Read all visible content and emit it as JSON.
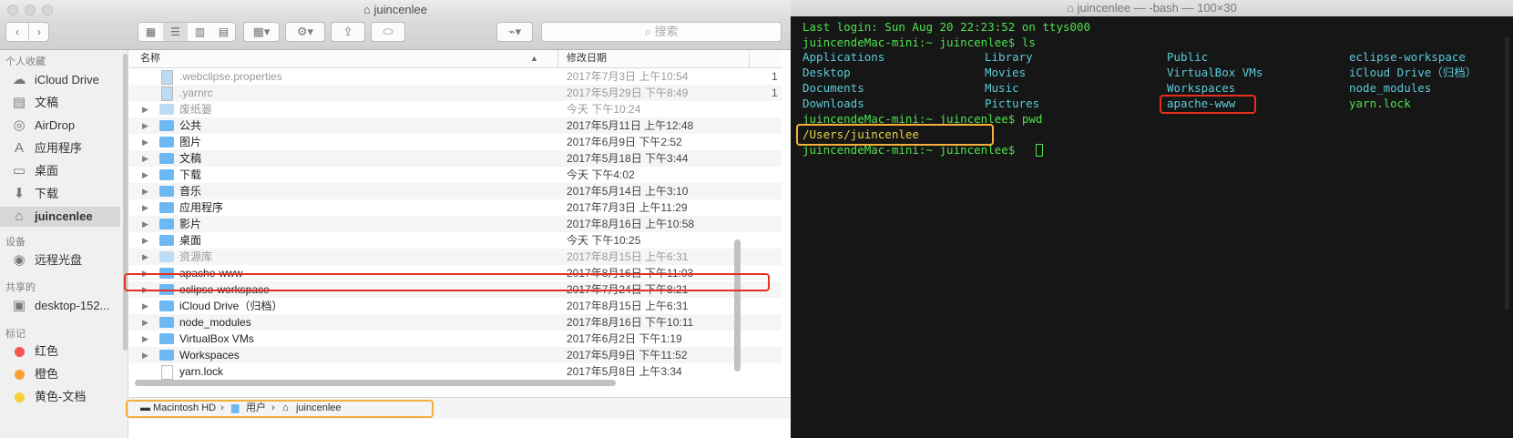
{
  "finder": {
    "title": "juincenlee",
    "search_placeholder": "搜索",
    "columns": {
      "name": "名称",
      "date": "修改日期"
    },
    "sidebar": {
      "sections": [
        {
          "header": "个人收藏",
          "items": [
            {
              "label": "iCloud Drive",
              "icon": "cloud-icon"
            },
            {
              "label": "文稿",
              "icon": "document-icon"
            },
            {
              "label": "AirDrop",
              "icon": "airdrop-icon"
            },
            {
              "label": "应用程序",
              "icon": "applications-icon"
            },
            {
              "label": "桌面",
              "icon": "desktop-icon"
            },
            {
              "label": "下载",
              "icon": "download-icon"
            },
            {
              "label": "juincenlee",
              "icon": "home-icon",
              "selected": true
            }
          ]
        },
        {
          "header": "设备",
          "items": [
            {
              "label": "远程光盘",
              "icon": "disc-icon"
            }
          ]
        },
        {
          "header": "共享的",
          "items": [
            {
              "label": "desktop-152...",
              "icon": "computer-icon"
            }
          ]
        },
        {
          "header": "标记",
          "items": [
            {
              "label": "红色",
              "color": "#f2574f"
            },
            {
              "label": "橙色",
              "color": "#f5a033"
            },
            {
              "label": "黄色-文档",
              "color": "#f5cf3a"
            }
          ]
        }
      ]
    },
    "rows": [
      {
        "name": ".webclipse.properties",
        "date": "2017年7月3日 上午10:54",
        "extra": "1",
        "type": "file",
        "dim": true,
        "expandable": false
      },
      {
        "name": ".yarnrc",
        "date": "2017年5月29日 下午8:49",
        "extra": "1",
        "type": "file",
        "dim": true,
        "expandable": false
      },
      {
        "name": "废纸篓",
        "date": "今天 下午10:24",
        "type": "folder",
        "dim": true,
        "expandable": true
      },
      {
        "name": "公共",
        "date": "2017年5月11日 上午12:48",
        "type": "folder",
        "expandable": true
      },
      {
        "name": "图片",
        "date": "2017年6月9日 下午2:52",
        "type": "folder",
        "expandable": true
      },
      {
        "name": "文稿",
        "date": "2017年5月18日 下午3:44",
        "type": "folder",
        "expandable": true
      },
      {
        "name": "下载",
        "date": "今天 下午4:02",
        "type": "folder",
        "expandable": true
      },
      {
        "name": "音乐",
        "date": "2017年5月14日 上午3:10",
        "type": "folder",
        "expandable": true
      },
      {
        "name": "应用程序",
        "date": "2017年7月3日 上午11:29",
        "type": "folder",
        "expandable": true
      },
      {
        "name": "影片",
        "date": "2017年8月16日 上午10:58",
        "type": "folder",
        "expandable": true
      },
      {
        "name": "桌面",
        "date": "今天 下午10:25",
        "type": "folder",
        "expandable": true
      },
      {
        "name": "资源库",
        "date": "2017年8月15日 上午6:31",
        "type": "folder",
        "dim": true,
        "expandable": true
      },
      {
        "name": "apache-www",
        "date": "2017年8月16日 下午11:03",
        "type": "folder",
        "expandable": true,
        "highlight": true
      },
      {
        "name": "eclipse-workspace",
        "date": "2017年7月24日 下午8:21",
        "type": "folder",
        "expandable": true
      },
      {
        "name": "iCloud Drive（归档）",
        "date": "2017年8月15日 上午6:31",
        "type": "folder",
        "expandable": true
      },
      {
        "name": "node_modules",
        "date": "2017年8月16日 下午10:11",
        "type": "folder",
        "expandable": true
      },
      {
        "name": "VirtualBox VMs",
        "date": "2017年6月2日 下午1:19",
        "type": "folder",
        "expandable": true
      },
      {
        "name": "Workspaces",
        "date": "2017年5月9日 下午11:52",
        "type": "folder",
        "expandable": true
      },
      {
        "name": "yarn.lock",
        "date": "2017年5月8日 上午3:34",
        "type": "file",
        "expandable": false
      }
    ],
    "path": [
      "Macintosh HD",
      "用户",
      "juincenlee"
    ],
    "path_sep": "›"
  },
  "terminal": {
    "title": "juincenlee — -bash — 100×30",
    "last_login": "Last login: Sun Aug 20 22:23:52 on ttys000",
    "prompt1": "juincendeMac-mini:~ juincenlee$ ls",
    "ls_columns": [
      [
        "Applications",
        "Desktop",
        "Documents",
        "Downloads"
      ],
      [
        "Library",
        "Movies",
        "Music",
        "Pictures"
      ],
      [
        "Public",
        "VirtualBox VMs",
        "Workspaces",
        "apache-www"
      ],
      [
        "eclipse-workspace",
        "iCloud Drive（归档）",
        "node_modules",
        "yarn.lock"
      ]
    ],
    "prompt2": "juincendeMac-mini:~ juincenlee$ pwd",
    "pwd_output": "/Users/juincenlee",
    "prompt3": "juincendeMac-mini:~ juincenlee$ "
  },
  "colors": {
    "highlight_red": "#e5301e",
    "highlight_orange": "#f4b03a",
    "terminal_green": "#4ee04e",
    "terminal_cyan": "#5bc9d9",
    "folder_blue": "#6cb8f2"
  }
}
